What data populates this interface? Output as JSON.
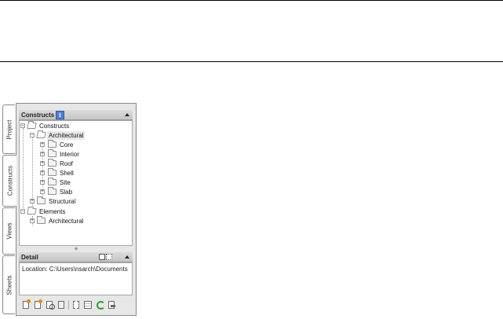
{
  "side_tabs": [
    "Project",
    "Constructs",
    "Views",
    "Sheets"
  ],
  "constructs_section": {
    "title": "Constructs",
    "info_glyph": "i",
    "tree": [
      {
        "label": "Constructs",
        "expander": "−",
        "icon": "open-folder-icon"
      },
      {
        "label": "Architectural",
        "expander": "−",
        "icon": "open-folder-icon"
      },
      {
        "label": "Core",
        "expander": "+",
        "icon": "folder-icon"
      },
      {
        "label": "Interior",
        "expander": "+",
        "icon": "folder-icon"
      },
      {
        "label": "Roof",
        "expander": "+",
        "icon": "folder-icon"
      },
      {
        "label": "Shell",
        "expander": "+",
        "icon": "folder-icon"
      },
      {
        "label": "Site",
        "expander": "+",
        "icon": "folder-icon"
      },
      {
        "label": "Slab",
        "expander": "+",
        "icon": "folder-icon"
      },
      {
        "label": "Structural",
        "expander": "+",
        "icon": "folder-icon"
      },
      {
        "label": "Elements",
        "expander": "−",
        "icon": "open-folder-icon"
      },
      {
        "label": "Architectural",
        "expander": "+",
        "icon": "folder-icon"
      }
    ]
  },
  "detail_section": {
    "title": "Detail",
    "location_text": "Location: C:\\Users\\nsarch\\Documents"
  },
  "toolbar_icons": [
    "add-category-icon",
    "add-construct-icon",
    "find-icon",
    "clipboard-icon",
    "tree-options-icon",
    "properties-icon",
    "refresh-icon",
    "repath-icon"
  ],
  "colors": {
    "info_badge": "#4f7fd1",
    "refresh_green": "#2e9b3a",
    "accent_orange": "#e08a1e",
    "frame_border": "#8a8a8a"
  }
}
